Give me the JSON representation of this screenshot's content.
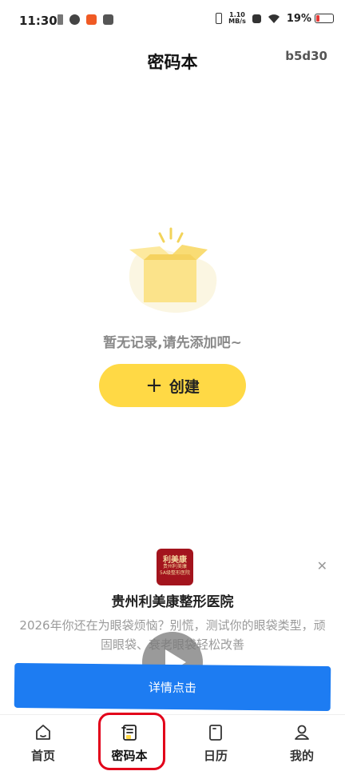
{
  "status_bar": {
    "time": "11:30",
    "net_speed_value": "1.10",
    "net_speed_unit": "MB/s",
    "battery": "19%",
    "battery_level": 0.19,
    "battery_color": "#e53935"
  },
  "header": {
    "title": "密码本",
    "corner_id": "b5d30"
  },
  "empty_state": {
    "message": "暂无记录,请先添加吧~",
    "create_label": "创建",
    "create_icon": "plus-icon",
    "accent_color": "#ffd945"
  },
  "ad": {
    "logo_text_top": "利美康",
    "logo_text_mid": "贵州利美康",
    "logo_text_bottom": "5A级整形医院",
    "name": "贵州利美康整形医院",
    "description": "2026年你还在为眼袋烦恼？别慌，测试你的眼袋类型，顽固眼袋、衰老眼袋轻松改善",
    "cta": "详情点击",
    "close_icon": "close-icon",
    "cta_color": "#1d7cf2"
  },
  "nav": {
    "items": [
      {
        "label": "首页",
        "icon": "home-icon"
      },
      {
        "label": "密码本",
        "icon": "notebook-icon"
      },
      {
        "label": "日历",
        "icon": "calendar-icon"
      },
      {
        "label": "我的",
        "icon": "profile-icon"
      }
    ],
    "active_index": 1
  }
}
